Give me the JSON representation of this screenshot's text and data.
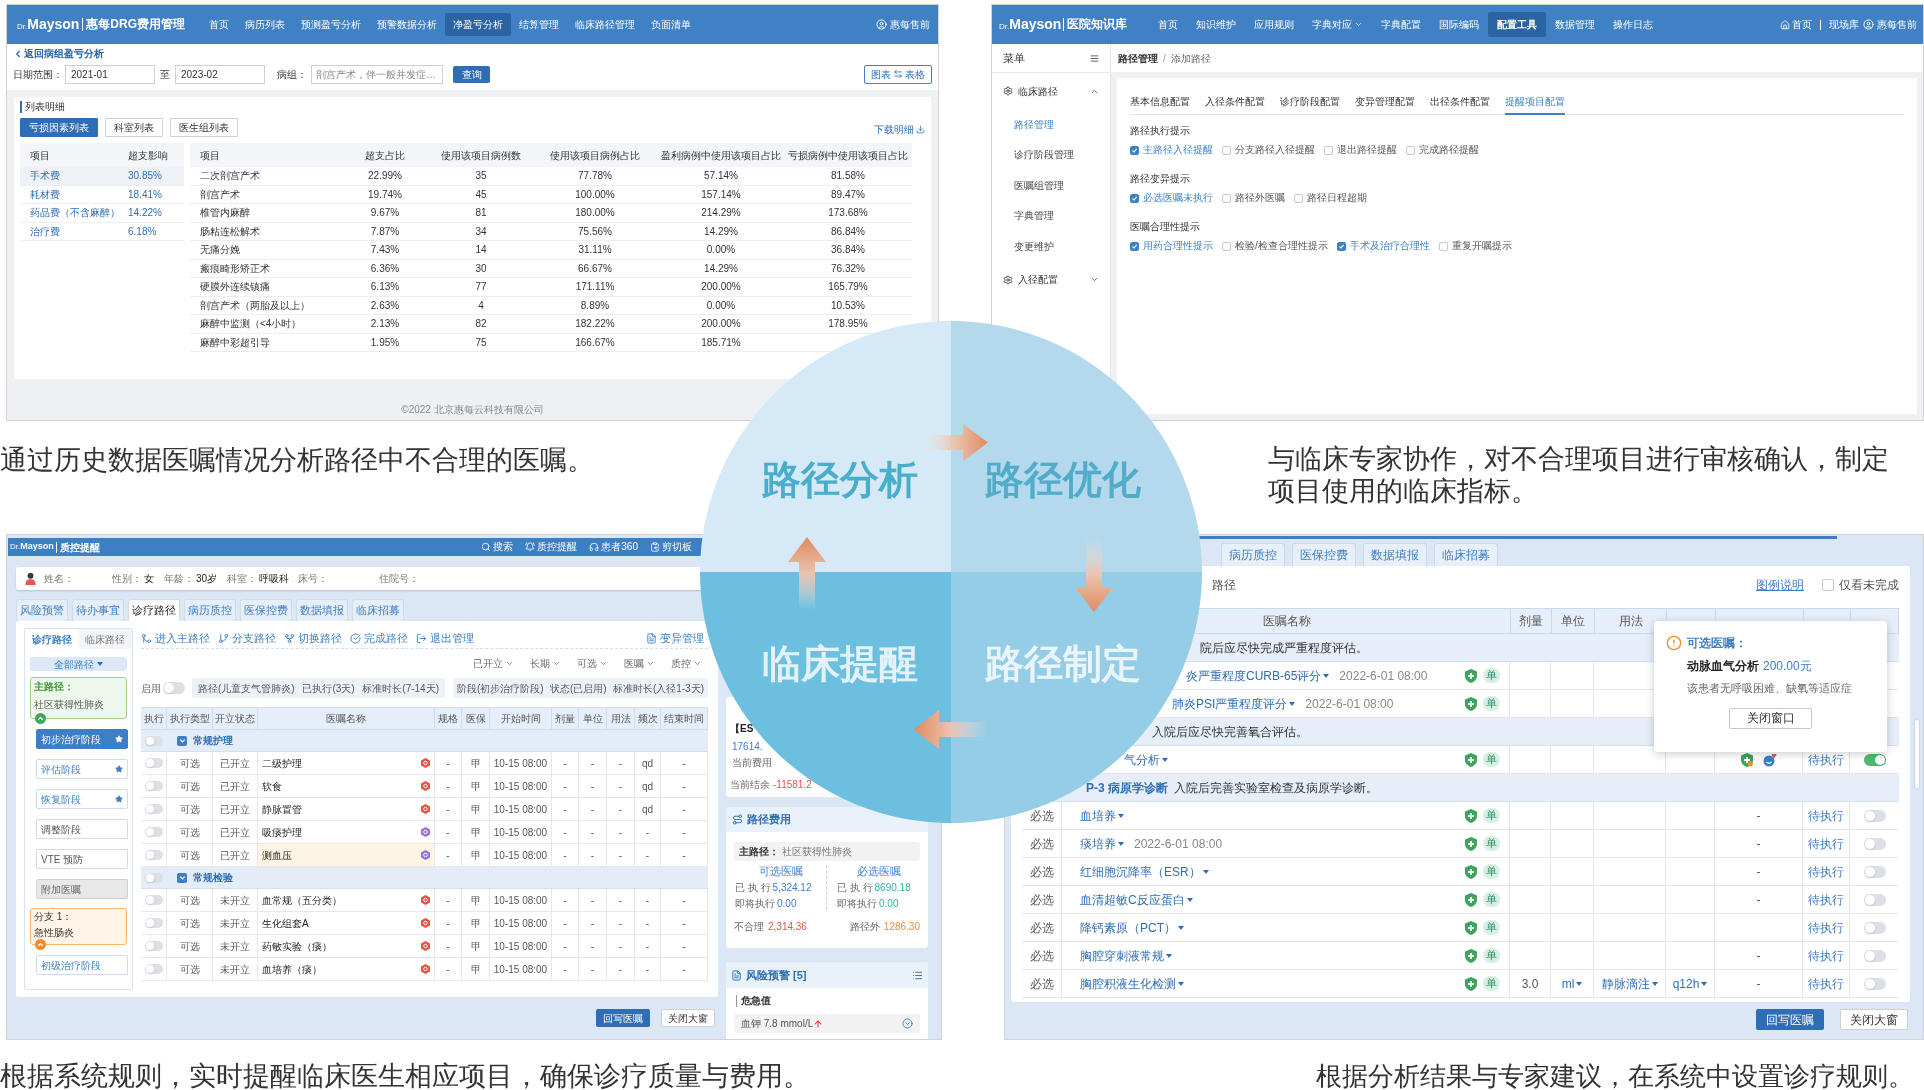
{
  "analysis_screen": {
    "navbar": {
      "logo_small": "Dr.",
      "logo_main": "Mayson",
      "product": "惠每DRG费用管理",
      "items": [
        {
          "label": "首页",
          "selected": false
        },
        {
          "label": "病历列表",
          "selected": false
        },
        {
          "label": "预测盈亏分析",
          "selected": false
        },
        {
          "label": "预警数据分析",
          "selected": false
        },
        {
          "label": "净盈亏分析",
          "selected": true
        },
        {
          "label": "结算管理",
          "selected": false
        },
        {
          "label": "临床路径管理",
          "selected": false
        },
        {
          "label": "负面清单",
          "selected": false
        }
      ],
      "user": "惠每售前"
    },
    "back_link": "返回病组盈亏分析",
    "filters": {
      "date_label": "日期范围：",
      "date_from": "2021-01",
      "date_separator": "至",
      "date_to": "2023-02",
      "group_label": "病组：",
      "group_value": "剖宫产术，伴一般并发症…",
      "query_button": "查询",
      "chart_label": "图表",
      "table_label": "表格"
    },
    "section_title": "列表明细",
    "view_tabs": [
      {
        "label": "亏损因素列表",
        "selected": true
      },
      {
        "label": "科室列表",
        "selected": false
      },
      {
        "label": "医生组列表",
        "selected": false
      }
    ],
    "download_link": "下载明细",
    "factor_table": {
      "columns": [
        "项目",
        "超支影响"
      ],
      "rows": [
        {
          "cells": [
            "手术费",
            "30.85%"
          ],
          "selected": true
        },
        {
          "cells": [
            "耗材费",
            "18.41%"
          ],
          "selected": false
        },
        {
          "cells": [
            "药品费（不含麻醉）",
            "14.22%"
          ],
          "selected": false
        },
        {
          "cells": [
            "治疗费",
            "6.18%"
          ],
          "selected": false
        }
      ]
    },
    "detail_table": {
      "columns": [
        "项目",
        "超支占比",
        "使用该项目病例数",
        "使用该项目病例占比",
        "盈利病例中使用该项目占比",
        "亏损病例中使用该项目占比"
      ],
      "rows": [
        [
          "二次剖宫产术",
          "22.99%",
          "35",
          "77.78%",
          "57.14%",
          "81.58%"
        ],
        [
          "剖宫产术",
          "19.74%",
          "45",
          "100.00%",
          "157.14%",
          "89.47%"
        ],
        [
          "椎管内麻醉",
          "9.67%",
          "81",
          "180.00%",
          "214.29%",
          "173.68%"
        ],
        [
          "肠粘连松解术",
          "7.87%",
          "34",
          "75.56%",
          "14.29%",
          "86.84%"
        ],
        [
          "无痛分娩",
          "7.43%",
          "14",
          "31.11%",
          "0.00%",
          "36.84%"
        ],
        [
          "瘢痕畸形矫正术",
          "6.36%",
          "30",
          "66.67%",
          "14.29%",
          "76.32%"
        ],
        [
          "硬膜外连续镇痛",
          "6.13%",
          "77",
          "171.11%",
          "200.00%",
          "165.79%"
        ],
        [
          "剖宫产术（两胎及以上）",
          "2.63%",
          "4",
          "8.89%",
          "0.00%",
          "10.53%"
        ],
        [
          "麻醉中监测（<4小时）",
          "2.13%",
          "82",
          "182.22%",
          "200.00%",
          "178.95%"
        ],
        [
          "麻醉中彩超引导",
          "1.95%",
          "75",
          "166.67%",
          "185.71%"
        ]
      ]
    },
    "footer": "©2022 北京惠每云科技有限公司",
    "caption": "通过历史数据医嘱情况分析路径中不合理的医嘱。"
  },
  "optimization_screen": {
    "navbar": {
      "logo_small": "Dr.",
      "logo_main": "Mayson",
      "product": "医院知识库",
      "items": [
        {
          "label": "首页",
          "selected": false,
          "dropdown": false
        },
        {
          "label": "知识维护",
          "selected": false,
          "dropdown": false
        },
        {
          "label": "应用规则",
          "selected": false,
          "dropdown": false
        },
        {
          "label": "字典对应",
          "selected": false,
          "dropdown": true
        },
        {
          "label": "字典配置",
          "selected": false,
          "dropdown": false
        },
        {
          "label": "国际编码",
          "selected": false,
          "dropdown": false
        },
        {
          "label": "配置工具",
          "selected": true,
          "dropdown": false
        },
        {
          "label": "数据管理",
          "selected": false,
          "dropdown": false
        },
        {
          "label": "操作日志",
          "selected": false,
          "dropdown": false
        }
      ],
      "home": "首页",
      "library": "现场库",
      "user": "惠每售前"
    },
    "sidebar": {
      "title": "菜单",
      "groups": [
        {
          "label": "临床路径",
          "expanded": true,
          "children": [
            {
              "label": "路径管理",
              "selected": true
            },
            {
              "label": "诊疗阶段管理",
              "selected": false
            },
            {
              "label": "医嘱组管理",
              "selected": false
            },
            {
              "label": "字典管理",
              "selected": false
            },
            {
              "label": "变更维护",
              "selected": false
            }
          ]
        },
        {
          "label": "入径配置",
          "expanded": false
        }
      ]
    },
    "breadcrumb": {
      "items": [
        "路径管理",
        "添加路径"
      ],
      "separator": "/"
    },
    "tabs": [
      {
        "label": "基本信息配置",
        "selected": false
      },
      {
        "label": "入径条件配置",
        "selected": false
      },
      {
        "label": "诊疗阶段配置",
        "selected": false
      },
      {
        "label": "变异管理配置",
        "selected": false
      },
      {
        "label": "出径条件配置",
        "selected": false
      },
      {
        "label": "提醒项目配置",
        "selected": true
      }
    ],
    "sections": [
      {
        "title": "路径执行提示",
        "options": [
          {
            "label": "主路径入径提醒",
            "checked": true
          },
          {
            "label": "分支路径入径提醒",
            "checked": false
          },
          {
            "label": "退出路径提醒",
            "checked": false
          },
          {
            "label": "完成路径提醒",
            "checked": false
          }
        ]
      },
      {
        "title": "路径变异提示",
        "options": [
          {
            "label": "必选医嘱未执行",
            "checked": true
          },
          {
            "label": "路径外医嘱",
            "checked": false
          },
          {
            "label": "路径日程超期",
            "checked": false
          }
        ]
      },
      {
        "title": "医嘱合理性提示",
        "options": [
          {
            "label": "用药合理性提示",
            "checked": true
          },
          {
            "label": "检验/检查合理性提示",
            "checked": false
          },
          {
            "label": "手术及治疗合理性",
            "checked": true
          },
          {
            "label": "重复开嘱提示",
            "checked": false
          }
        ]
      }
    ],
    "caption": "与临床专家协作，对不合理项目进行审核确认，制定项目使用的临床指标。"
  },
  "cycle_diagram": {
    "stages": [
      {
        "label": "路径分析"
      },
      {
        "label": "路径优化"
      },
      {
        "label": "临床提醒"
      },
      {
        "label": "路径制定"
      }
    ]
  },
  "reminder_screen": {
    "titlebar": {
      "logo_small": "Dr.",
      "logo_main": "Mayson",
      "product": "质控提醒",
      "actions": [
        "搜索",
        "质控提醒",
        "患者360",
        "剪切板"
      ]
    },
    "patient": [
      {
        "label": "姓名："
      },
      {
        "label": "性别：",
        "value": "女"
      },
      {
        "label": "年龄：",
        "value": "30岁"
      },
      {
        "label": "科室：",
        "value": "呼吸科"
      },
      {
        "label": "床号："
      },
      {
        "label": "住院号："
      }
    ],
    "tabs": [
      {
        "label": "风险预警",
        "selected": false
      },
      {
        "label": "待办事宜",
        "selected": false
      },
      {
        "label": "诊疗路径",
        "selected": true
      },
      {
        "label": "病历质控",
        "selected": false
      },
      {
        "label": "医保控费",
        "selected": false
      },
      {
        "label": "数据填报",
        "selected": false
      },
      {
        "label": "临床招募",
        "selected": false
      }
    ],
    "side_tabs": [
      {
        "label": "诊疗路径",
        "selected": true
      },
      {
        "label": "临床路径",
        "selected": false
      }
    ],
    "path_filter": "全部路径",
    "main_path": {
      "label": "主路径：",
      "name": "社区获得性肺炎"
    },
    "stages": [
      {
        "label": "初步治疗阶段",
        "kind": "stage",
        "selected": true,
        "starred": true
      },
      {
        "label": "评估阶段",
        "kind": "stage",
        "selected": false,
        "starred": true
      },
      {
        "label": "恢复阶段",
        "kind": "stage",
        "selected": false,
        "starred": true
      },
      {
        "label": "调整阶段",
        "kind": "plain",
        "selected": false,
        "starred": false
      },
      {
        "label": "VTE 预防",
        "kind": "plain",
        "selected": false,
        "starred": false
      },
      {
        "label": "附加医嘱",
        "kind": "extra",
        "selected": false,
        "starred": false
      }
    ],
    "branch": {
      "label": "分支 1：",
      "name": "急性肠炎",
      "stages": [
        {
          "label": "初级治疗阶段",
          "kind": "stage",
          "selected": false,
          "starred": false
        }
      ]
    },
    "toolbar": [
      "进入主路径",
      "分支路径",
      "切换路径",
      "完成路径",
      "退出管理"
    ],
    "variance_button": "变异管理",
    "filters": [
      "已开立",
      "长期",
      "可选",
      "医嘱",
      "质控"
    ],
    "enable": {
      "label": "启用",
      "on": false
    },
    "path_info": [
      "路径(儿童支气管肺炎)",
      "已执行(3天)",
      "标准时长(7-14天)"
    ],
    "stage_info": [
      "阶段(初步治疗阶段)",
      "状态(已启用)",
      "标准时长(入径1-3天)"
    ],
    "order_table": {
      "columns": [
        "执行",
        "执行类型",
        "开立状态",
        "医嘱名称",
        "规格",
        "医保",
        "开始时间",
        "剂量",
        "单位",
        "用法",
        "频次",
        "结束时间"
      ],
      "groups": [
        {
          "name": "常规护理",
          "on": false,
          "expanded": true,
          "rows": [
            {
              "on": false,
              "highlighted": false,
              "color": "#e8504a",
              "cells": [
                "可选",
                "已开立",
                "二级护理",
                "-",
                "甲",
                "10-15 08:00",
                "-",
                "-",
                "-",
                "qd",
                "-"
              ]
            },
            {
              "on": false,
              "highlighted": false,
              "color": "#e8504a",
              "cells": [
                "可选",
                "已开立",
                "软食",
                "-",
                "甲",
                "10-15 08:00",
                "-",
                "-",
                "-",
                "qd",
                "-"
              ]
            },
            {
              "on": false,
              "highlighted": false,
              "color": "#e8504a",
              "cells": [
                "可选",
                "已开立",
                "静脉置管",
                "-",
                "甲",
                "10-15 08:00",
                "-",
                "-",
                "-",
                "qd",
                "-"
              ]
            },
            {
              "on": false,
              "highlighted": false,
              "color": "#9b72d8",
              "cells": [
                "可选",
                "已开立",
                "吸痰护理",
                "-",
                "甲",
                "10-15 08:00",
                "-",
                "-",
                "-",
                "-",
                "-"
              ]
            },
            {
              "on": false,
              "highlighted": true,
              "color": "#9b72d8",
              "cells": [
                "可选",
                "已开立",
                "测血压",
                "-",
                "甲",
                "10-15 08:00",
                "-",
                "-",
                "-",
                "-",
                "-"
              ]
            }
          ]
        },
        {
          "name": "常规检验",
          "on": false,
          "expanded": true,
          "rows": [
            {
              "on": false,
              "highlighted": false,
              "color": "#e8504a",
              "cells": [
                "可选",
                "未开立",
                "血常规（五分类）",
                "-",
                "甲",
                "10-15 08:00",
                "-",
                "-",
                "-",
                "-",
                "-"
              ]
            },
            {
              "on": false,
              "highlighted": false,
              "color": "#e8504a",
              "cells": [
                "可选",
                "未开立",
                "生化组套A",
                "-",
                "甲",
                "10-15 08:00",
                "-",
                "-",
                "-",
                "-",
                "-"
              ]
            },
            {
              "on": false,
              "highlighted": false,
              "color": "#e8504a",
              "cells": [
                "可选",
                "未开立",
                "药敏实验（痰）",
                "-",
                "甲",
                "10-15 08:00",
                "-",
                "-",
                "-",
                "-",
                "-"
              ]
            },
            {
              "on": false,
              "highlighted": false,
              "color": "#e8504a",
              "cells": [
                "可选",
                "未开立",
                "血培养（痰）",
                "-",
                "甲",
                "10-15 08:00",
                "-",
                "-",
                "-",
                "-",
                "-"
              ]
            }
          ]
        }
      ]
    },
    "side_panel": {
      "balance_card": {
        "code": "【ES",
        "amount": "17614.",
        "cost_label": "当前费用",
        "balance_label": "当前结余",
        "balance": "-11581.2"
      },
      "path_cost": {
        "title": "路径费用",
        "main_path_label": "主路径：",
        "main_path": "社区获得性肺炎",
        "columns": [
          {
            "title": "可选医嘱",
            "executed_label": "已 执 行",
            "executed": "5,324.12",
            "pending_label": "即将执行",
            "pending": "0.00",
            "color": "#3a7bd5"
          },
          {
            "title": "必选医嘱",
            "executed_label": "已 执 行",
            "executed": "8690.18",
            "pending_label": "即将执行",
            "pending": "0.00",
            "color": "#2fb3a3"
          }
        ],
        "unreasonable_label": "不合理",
        "unreasonable": "2,314.36",
        "off_path_label": "路径外",
        "off_path": "1286.30"
      },
      "risk": {
        "title": "风险预警 [5]",
        "section": "危急值",
        "items": [
          "血钾 7.8 mmol/L"
        ]
      }
    },
    "buttons": [
      {
        "label": "回写医嘱",
        "primary": true
      },
      {
        "label": "关闭大窗",
        "primary": false
      }
    ],
    "caption": "根据系统规则，实时提醒临床医生相应项目，确保诊疗质量与费用。"
  },
  "rule_screen": {
    "tabs": [
      {
        "label": "病历质控",
        "selected": false
      },
      {
        "label": "医保控费",
        "selected": false
      },
      {
        "label": "数据填报",
        "selected": false
      },
      {
        "label": "临床招募",
        "selected": false
      }
    ],
    "subtab": "路径",
    "legend_link": "图例说明",
    "only_unfinished": {
      "label": "仅看未完成",
      "checked": false
    },
    "columns": [
      "医嘱名称",
      "剂量",
      "单位",
      "用法"
    ],
    "groups": [
      {
        "text": "院后应尽快完成严重程度评估。",
        "rows": [
          {
            "name": "炎严重程度CURB-65评分",
            "date": "2022-6-01 08:00",
            "badge": "单",
            "alert_icons": false
          },
          {
            "name": "肺炎PSI严重程度评分",
            "date": "2022-6-01 08:00",
            "badge": "单",
            "alert_icons": false
          }
        ]
      },
      {
        "text": "入院后应尽快完善氧合评估。",
        "rows": [
          {
            "name": "气分析",
            "badge": "单",
            "alert_icons": true,
            "status": "待执行",
            "writeback": true
          }
        ]
      },
      {
        "code": "P-3 病原学诊断",
        "text": "入院后完善实验室检查及病原学诊断。",
        "rows": [
          {
            "type": "必选",
            "name": "血培养",
            "badge": "单",
            "alert_icons": false,
            "remark": "-",
            "status": "待执行",
            "writeback": false
          },
          {
            "type": "必选",
            "name": "痰培养",
            "date": "2022-6-01 08:00",
            "badge": "单",
            "alert_icons": false,
            "remark": "-",
            "status": "待执行",
            "writeback": false
          },
          {
            "type": "必选",
            "name": "红细胞沉降率（ESR）",
            "badge": "单",
            "alert_icons": false,
            "remark": "-",
            "status": "待执行",
            "writeback": false
          },
          {
            "type": "必选",
            "name": "血清超敏C反应蛋白",
            "badge": "单",
            "alert_icons": false,
            "remark": "-",
            "status": "待执行",
            "writeback": false
          },
          {
            "type": "必选",
            "name": "降钙素原（PCT）",
            "badge": "单",
            "alert_icons": false,
            "status": "待执行",
            "writeback": false
          },
          {
            "type": "必选",
            "name": "胸腔穿刺液常规",
            "badge": "单",
            "alert_icons": false,
            "remark": "-",
            "status": "待执行",
            "writeback": false
          },
          {
            "type": "必选",
            "name": "胸腔积液生化检测",
            "badge": "单",
            "dose": "3.0",
            "unit": "ml",
            "usage": "静脉滴注",
            "frequency": "q12h",
            "alert_icons": false,
            "remark": "-",
            "status": "待执行",
            "writeback": false
          }
        ]
      }
    ],
    "popup": {
      "title": "可选医嘱：",
      "item": "动脉血气分析",
      "price": "200.00元",
      "note": "该患者无呼吸困难、缺氧等适应症",
      "button": "关闭窗口"
    },
    "buttons": [
      {
        "label": "回写医嘱",
        "primary": true
      },
      {
        "label": "关闭大窗",
        "primary": false
      }
    ],
    "caption": "根据分析结果与专家建议，在系统中设置诊疗规则。"
  }
}
